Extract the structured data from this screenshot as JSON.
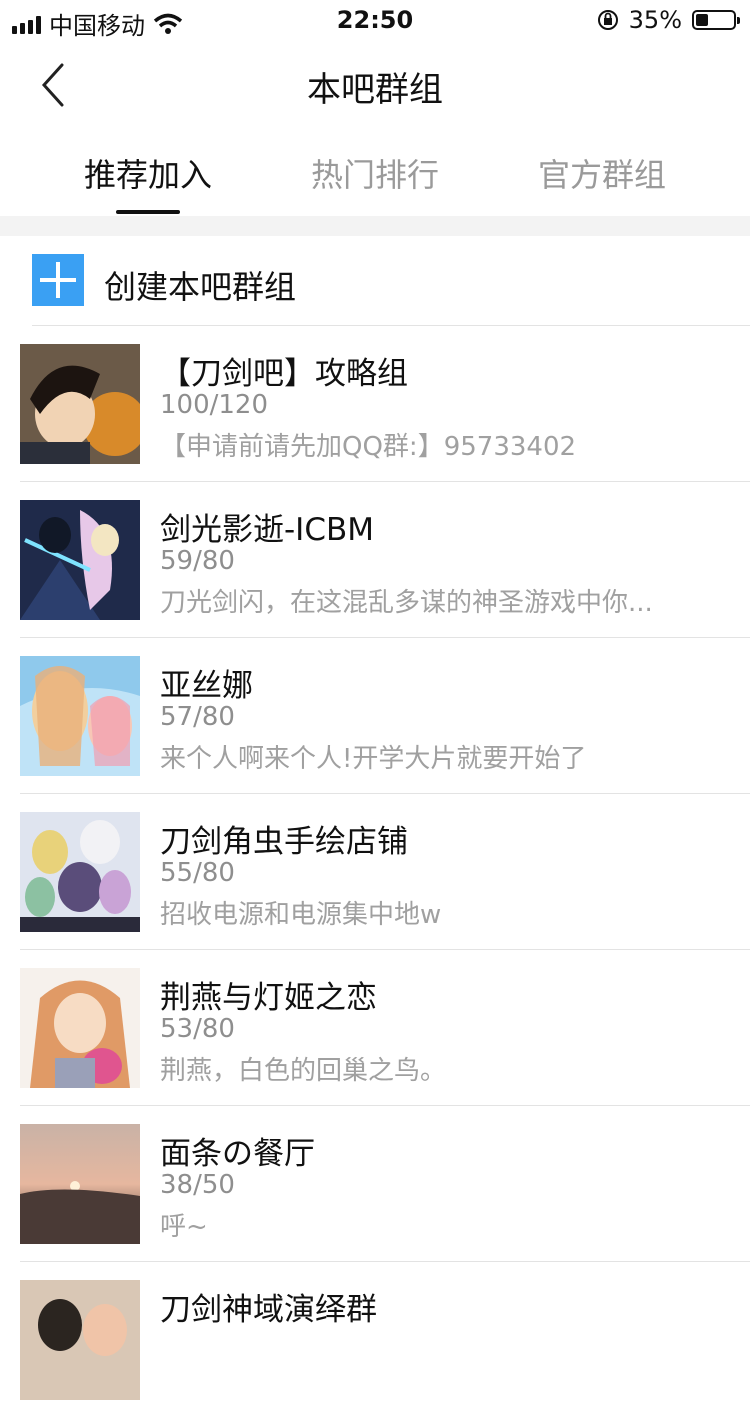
{
  "status_bar": {
    "carrier": "中国移动",
    "time": "22:50",
    "battery": "35%"
  },
  "nav": {
    "title": "本吧群组",
    "back_icon": "chevron-left-icon"
  },
  "tabs": [
    {
      "label": "推荐加入",
      "active": true
    },
    {
      "label": "热门排行",
      "active": false
    },
    {
      "label": "官方群组",
      "active": false
    }
  ],
  "create": {
    "label": "创建本吧群组",
    "icon": "plus-icon",
    "color": "#3aa0f3"
  },
  "groups": [
    {
      "title": "【刀剑吧】攻略组",
      "count": "100/120",
      "desc": "【申请前请先加QQ群:】95733402"
    },
    {
      "title": "剑光影逝-ICBM",
      "count": "59/80",
      "desc": "刀光剑闪，在这混乱多谋的神圣游戏中你..."
    },
    {
      "title": "亚丝娜",
      "count": "57/80",
      "desc": "来个人啊来个人!开学大片就要开始了"
    },
    {
      "title": "刀剑角虫手绘店铺",
      "count": "55/80",
      "desc": "招收电源和电源集中地w"
    },
    {
      "title": "荆燕与灯姬之恋",
      "count": "53/80",
      "desc": "荆燕，白色的回巢之鸟。"
    },
    {
      "title": "面条の餐厅",
      "count": "38/50",
      "desc": "呼~"
    },
    {
      "title": "刀剑神域演绎群",
      "count": "",
      "desc": ""
    }
  ]
}
